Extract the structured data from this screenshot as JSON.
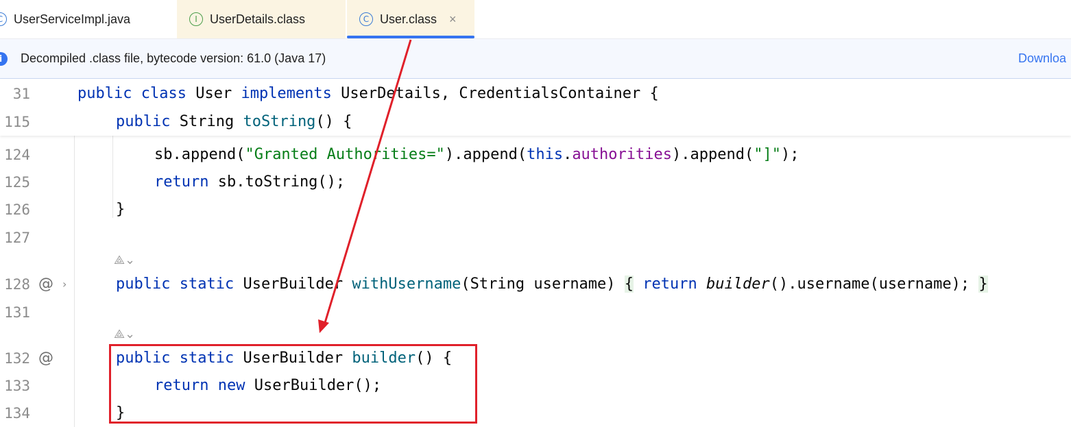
{
  "tabs": [
    {
      "label": "UserServiceImpl.java",
      "icon": "class-icon",
      "active": false
    },
    {
      "label": "UserDetails.class",
      "icon": "interface-icon",
      "active": false
    },
    {
      "label": "User.class",
      "icon": "class-icon",
      "active": true,
      "close": "×"
    }
  ],
  "banner": {
    "text": "Decompiled .class file, bytecode version: 61.0 (Java 17)",
    "link": "Downloa"
  },
  "icons": {
    "class_glyph": "C",
    "interface_glyph": "I",
    "info_glyph": "i",
    "at_glyph": "@",
    "chevron_glyph": "›",
    "ai_glyph": "⟁⌄"
  },
  "lines": {
    "l31": "31",
    "l115": "115",
    "l124": "124",
    "l125": "125",
    "l126": "126",
    "l127": "127",
    "l128": "128",
    "l131": "131",
    "l132": "132",
    "l133": "133",
    "l134": "134"
  },
  "code": {
    "l31": {
      "kw1": "public",
      "kw2": "class",
      "name": "User",
      "kw3": "implements",
      "rest": "UserDetails, CredentialsContainer {"
    },
    "l115": {
      "kw1": "public",
      "type": "String",
      "fn": "toString",
      "rest": "() {"
    },
    "l124": {
      "a": "sb.append(",
      "s1": "\"Granted Authorities=\"",
      "b": ").append(",
      "kw": "this",
      "dot": ".",
      "fld": "authorities",
      "c": ").append(",
      "s2": "\"]\"",
      "d": ");"
    },
    "l125": {
      "kw": "return",
      "rest": "sb.toString();"
    },
    "l126": {
      "rest": "}"
    },
    "l128": {
      "kw1": "public",
      "kw2": "static",
      "type": "UserBuilder",
      "fn": "withUsername",
      "params": "(String username)",
      "ob": "{",
      "kw3": "return",
      "call": "builder",
      "rest": "().username(username);",
      "cb": "}"
    },
    "l132": {
      "kw1": "public",
      "kw2": "static",
      "type": "UserBuilder",
      "fn": "builder",
      "rest": "() {"
    },
    "l133": {
      "kw1": "return",
      "kw2": "new",
      "rest": "UserBuilder();"
    },
    "l134": {
      "rest": "}"
    }
  },
  "colors": {
    "annotation": "#e0202a",
    "accent": "#3574f0"
  }
}
